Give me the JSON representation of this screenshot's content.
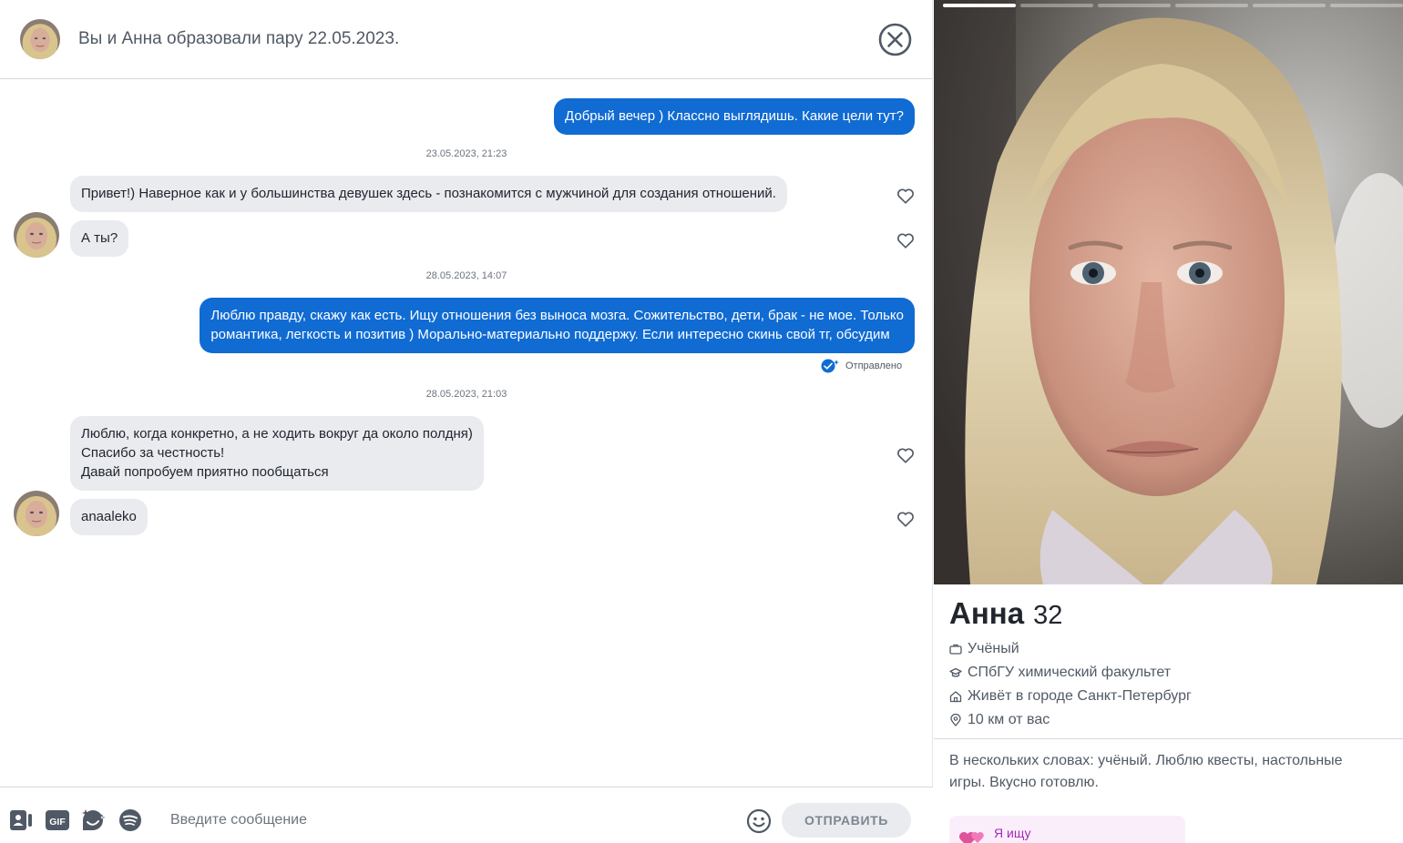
{
  "header": {
    "title": "Вы и Анна образовали пару 22.05.2023."
  },
  "messages": [
    {
      "direction": "out",
      "text": "Добрый вечер ) Классно выглядишь. Какие цели тут?"
    },
    {
      "timestamp": "23.05.2023, 21:23"
    },
    {
      "direction": "in",
      "text": "Привет!) Наверное как и у большинства девушек здесь - познакомится с мужчиной для создания отношений."
    },
    {
      "direction": "in",
      "text": "А ты?"
    },
    {
      "timestamp": "28.05.2023, 14:07"
    },
    {
      "direction": "out",
      "lines": [
        "Люблю правду, скажу как есть. Ищу отношения без выноса мозга. Сожительство, дети, брак - не мое. Только",
        "романтика, легкость и позитив ) Морально-материально поддержу. Если интересно скинь свой тг, обсудим"
      ],
      "status": "Отправлено"
    },
    {
      "timestamp": "28.05.2023, 21:03"
    },
    {
      "direction": "in",
      "lines": [
        "Люблю, когда конкретно, а не ходить вокруг да около полдня)",
        "Спасибо за честность!",
        "Давай попробуем приятно пообщаться"
      ]
    },
    {
      "direction": "in",
      "text": "anaaleko"
    }
  ],
  "composer": {
    "placeholder": "Введите сообщение",
    "send_label": "ОТПРАВИТЬ",
    "tools": [
      "contact-card-icon",
      "gif-icon",
      "sticker-icon",
      "spotify-icon"
    ]
  },
  "profile": {
    "name": "Анна",
    "age": "32",
    "photo_count": 6,
    "active_photo": 1,
    "facts": [
      {
        "icon": "briefcase-icon",
        "text": "Учёный"
      },
      {
        "icon": "graduation-cap-icon",
        "text": "СПбГУ химический факультет"
      },
      {
        "icon": "home-icon",
        "text": "Живёт в городе Санкт-Петербург"
      },
      {
        "icon": "location-pin-icon",
        "text": "10 км от вас"
      }
    ],
    "bio": "В нескольких словах: учёный. Люблю квесты, настольные игры. Вкусно готовлю.",
    "looking_for_label": "Я ищу"
  },
  "colors": {
    "outgoing_bubble": "#106bd3",
    "incoming_bubble": "#e9ebef",
    "accent_purple": "#a12bb6"
  }
}
